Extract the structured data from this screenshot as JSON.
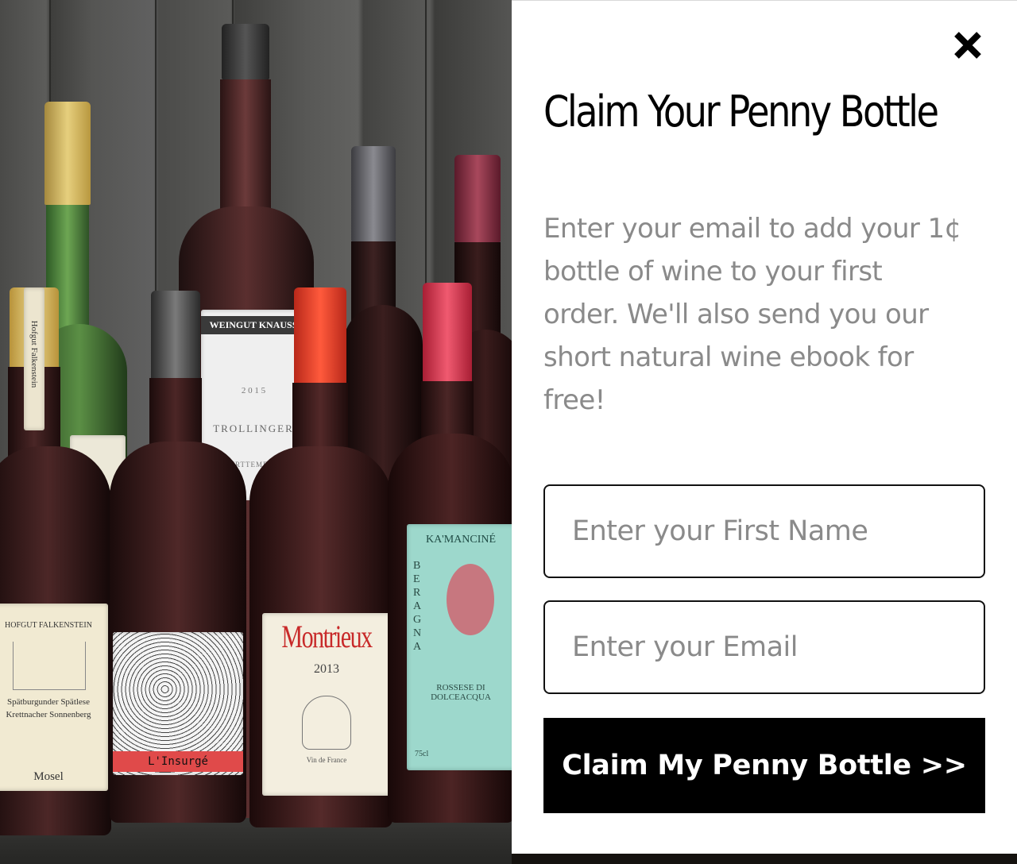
{
  "modal": {
    "title": "Claim Your Penny Bottle",
    "description": "Enter your email to add your 1¢ bottle of wine to your first order. We'll also send you our short natural wine ebook for free!",
    "first_name_placeholder": "Enter your First Name",
    "email_placeholder": "Enter your Email",
    "submit_label": "Claim My Penny Bottle >>",
    "close_icon": "close-icon"
  },
  "photo": {
    "labels": {
      "falkenstein_neck": "Hofgut Falkenstein",
      "falkenstein_top": "HOFGUT FALKENSTEIN",
      "falkenstein_mid": "Spätburgunder Spätlese",
      "falkenstein_mid2": "Krettnacher Sonnenberg",
      "falkenstein_bottom": "Mosel",
      "insurge": "L'Insurgé",
      "trollinger_brand": "WEINGUT KNAUSS",
      "trollinger_year": "2 0 1 5",
      "trollinger_name": "TROLLINGER",
      "trollinger_region": "WÜRTTEMBERG",
      "montrieux": "Montrieux",
      "montrieux_year": "2013",
      "montrieux_sub": "Vin de France",
      "kamancine": "KA'MANCINÉ",
      "beragna": "BERAGNA",
      "kamancine_wine": "ROSSESE DI DOLCEACQUA",
      "kamancine_vol": "75cl"
    }
  }
}
